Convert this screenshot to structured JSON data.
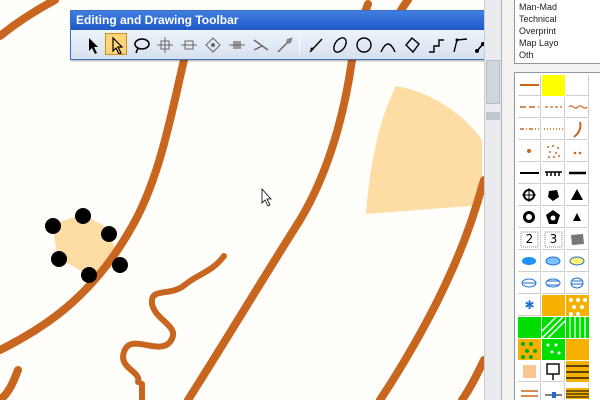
{
  "toolbar": {
    "title": "Editing and Drawing Toolbar",
    "dropdown_glyph": "▾",
    "close_glyph": "✕",
    "tools": [
      {
        "name": "select-arrow-icon"
      },
      {
        "name": "edit-pointer-icon",
        "active": true
      },
      {
        "name": "lasso-icon"
      },
      {
        "name": "move-vertex-icon"
      },
      {
        "name": "add-vertex-icon"
      },
      {
        "name": "rotate-icon"
      },
      {
        "name": "delete-vertex-icon"
      },
      {
        "name": "cut-path-icon"
      },
      {
        "name": "reshape-icon"
      },
      {
        "name": "straight-line-icon"
      },
      {
        "name": "ellipse-icon"
      },
      {
        "name": "circle-icon"
      },
      {
        "name": "curve-icon"
      },
      {
        "name": "polygon-icon"
      },
      {
        "name": "step-line-icon"
      },
      {
        "name": "bezier-icon"
      },
      {
        "name": "polyline-node-icon"
      },
      {
        "name": "dashed-line-icon"
      },
      {
        "name": "measure-icon"
      }
    ]
  },
  "documents": [
    "Man-Mad",
    "Technical",
    "Overprint",
    "Map Layo",
    "Oth"
  ],
  "palette": {
    "rows": [
      [
        "brown-line",
        "yellow-area",
        "empty"
      ],
      [
        "brown-dash",
        "brown-chain",
        "brown-chain2"
      ],
      [
        "brown-dotdash",
        "brown-dotline",
        "brown-curve"
      ],
      [
        "brown-dot",
        "brown-dots-area",
        "brown-tiny-dots"
      ],
      [
        "black-line",
        "black-comb",
        "black-bar"
      ],
      [
        "black-cross",
        "black-blob",
        "black-triangle"
      ],
      [
        "black-star-ring",
        "black-pentagon",
        "black-triangle-small"
      ],
      [
        "text-2",
        "text-3",
        "gray-blob"
      ],
      [
        "blue-ellipse",
        "blue-ellipse-outline",
        "yellow-blue-ellipse"
      ],
      [
        "blue-striped",
        "blue-striped2",
        "blue-striped3"
      ],
      [
        "blue-asterisk",
        "orange-area",
        "orange-dots-area"
      ],
      [
        "green-area",
        "green-hatch",
        "green-white-stripes"
      ],
      [
        "yellow-green-dots",
        "green-dots-area",
        "yellow-area-2"
      ],
      [
        "tan-square",
        "white-post",
        "orange-stripes"
      ],
      [
        "brown-double",
        "blue-mark",
        "striped-bar"
      ]
    ],
    "glyphs": {
      "text-2": "2",
      "text-3": "3",
      "blue-asterisk": "✱"
    }
  },
  "colors": {
    "contour": "#c8661f",
    "sand": "#fddda3",
    "toolbar_blue": "#2158c8",
    "active_tool": "#ffd57a"
  }
}
